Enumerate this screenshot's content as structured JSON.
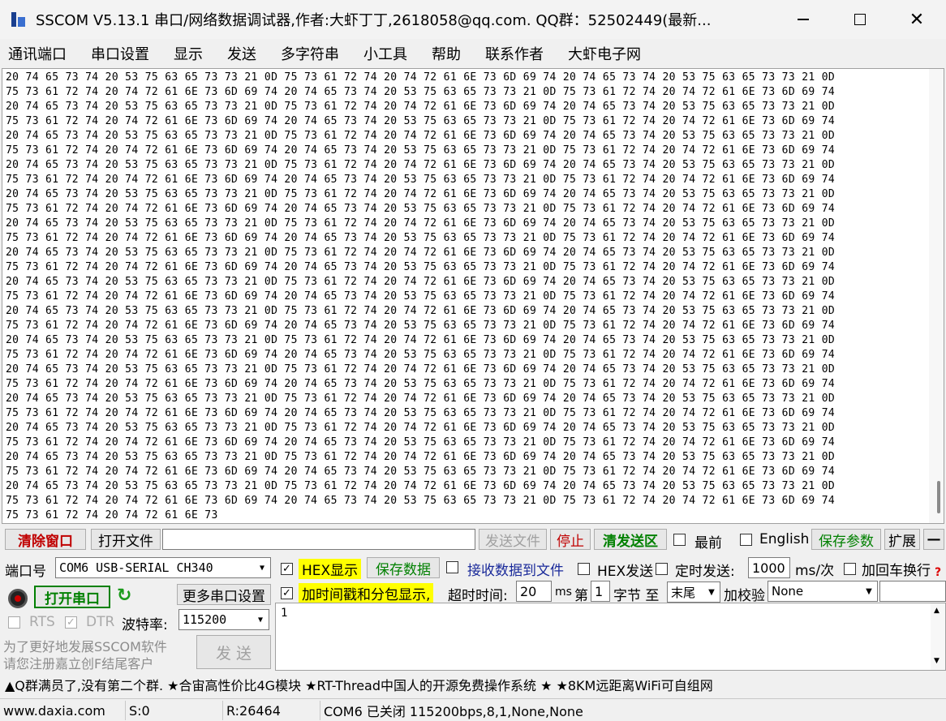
{
  "window": {
    "title": "SSCOM V5.13.1 串口/网络数据调试器,作者:大虾丁丁,2618058@qq.com. QQ群：52502449(最新..."
  },
  "menu": [
    "通讯端口",
    "串口设置",
    "显示",
    "发送",
    "多字符串",
    "小工具",
    "帮助",
    "联系作者",
    "大虾电子网"
  ],
  "receive": {
    "line_a": "20 74 65 73 74 20 53 75 63 65 73 73 21 0D 75 73 61 72 74 20 74 72 61 6E 73 6D 69 74 20 74 65 73 74 20 53 75 63 65 73 73 21 0D",
    "line_b": "75 73 61 72 74 20 74 72 61 6E 73 6D 69 74 20 74 65 73 74 20 53 75 63 65 73 73 21 0D 75 73 61 72 74 20 74 72 61 6E 73 6D 69 74",
    "last_line": "75 73 61 72 74 20 74 72 61 6E 73"
  },
  "toolbar": {
    "clear_window": "清除窗口",
    "open_file": "打开文件",
    "send_file": "发送文件",
    "stop": "停止",
    "clear_send": "清发送区",
    "topmost": "最前",
    "english": "English",
    "save_params": "保存参数",
    "expand": "扩展",
    "collapse": "—"
  },
  "port": {
    "port_label": "端口号",
    "port_value": "COM6 USB-SERIAL CH340",
    "open_port": "打开串口",
    "more_settings": "更多串口设置",
    "rts": "RTS",
    "dtr": "DTR",
    "baud_label": "波特率:",
    "baud_value": "115200",
    "promo_line1": "为了更好地发展SSCOM软件",
    "promo_line2": "请您注册嘉立创F结尾客户",
    "send": "发  送"
  },
  "options": {
    "hex_display": "HEX显示",
    "save_data": "保存数据",
    "recv_to_file": "接收数据到文件",
    "hex_send": "HEX发送",
    "timed_send": "定时发送:",
    "interval": "1000",
    "interval_unit": "ms/次",
    "add_crlf": "加回车换行",
    "timestamp": "加时间戳和分包显示,",
    "timeout_label": "超时时间:",
    "timeout_value": "20",
    "timeout_unit": "ms",
    "byte_from_label": "第",
    "byte_from": "1",
    "byte_label": "字节 至",
    "byte_to": "末尾",
    "checksum_label": "加校验",
    "checksum": "None"
  },
  "send_text": "1",
  "marquee": "▲Q群满员了,没有第二个群. ★合宙高性价比4G模块 ★RT-Thread中国人的开源免费操作系统 ★ ★8KM远距离WiFi可自组网",
  "status": {
    "site": "www.daxia.com",
    "sent": "S:0",
    "received": "R:26464",
    "port_state": "COM6 已关闭  115200bps,8,1,None,None"
  }
}
